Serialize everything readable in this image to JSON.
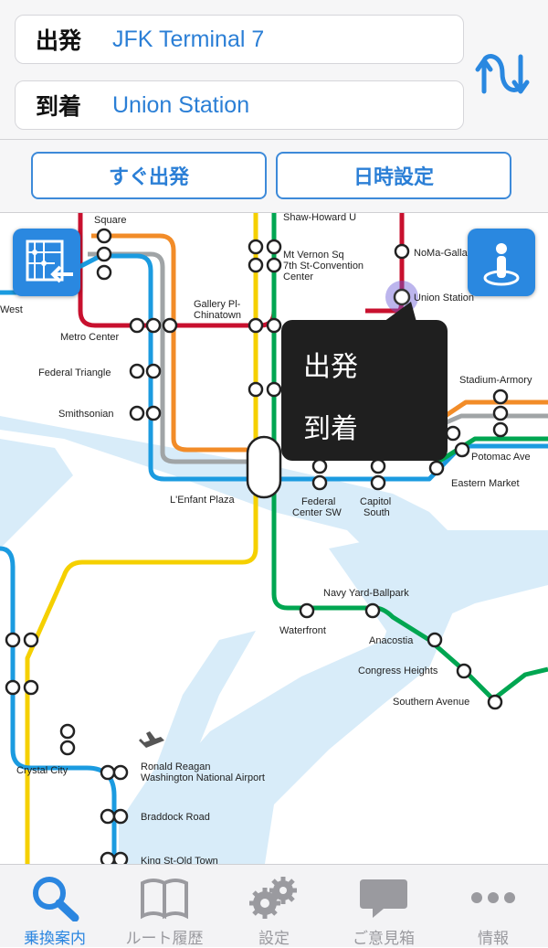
{
  "route": {
    "origin_label": "出発",
    "origin_value": "JFK Terminal 7",
    "destination_label": "到着",
    "destination_value": "Union Station"
  },
  "actions": {
    "depart_now": "すぐ出発",
    "set_datetime": "日時設定"
  },
  "popover": {
    "depart": "出発",
    "arrive": "到着"
  },
  "map": {
    "stations": {
      "square": "Square",
      "shaw": "Shaw-Howard U",
      "noma": "NoMa-Gallaudet",
      "union": "Union Station",
      "mtvernon1": "Mt Vernon Sq",
      "mtvernon2": "7th St-Convention",
      "mtvernon3": "Center",
      "gallery1": "Gallery Pl-",
      "gallery2": "Chinatown",
      "metro_center": "Metro Center",
      "federal_triangle": "Federal Triangle",
      "smithsonian": "Smithsonian",
      "lenfant": "L'Enfant Plaza",
      "federal_sw1": "Federal",
      "federal_sw2": "Center SW",
      "capitol_south1": "Capitol",
      "capitol_south2": "South",
      "stadium": "Stadium-Armory",
      "potomac": "Potomac Ave",
      "eastern": "Eastern Market",
      "navy_yard": "Navy Yard-Ballpark",
      "waterfront": "Waterfront",
      "anacostia": "Anacostia",
      "congress": "Congress Heights",
      "southern": "Southern Avenue",
      "crystal": "Crystal City",
      "reagan1": "Ronald Reagan",
      "reagan2": "Washington National Airport",
      "braddock": "Braddock Road",
      "kingst": "King St-Old Town",
      "west": "West"
    },
    "line_colors": {
      "red": "#c8102e",
      "orange": "#f28c28",
      "silver": "#a0a4a6",
      "blue": "#1b9be0",
      "yellow": "#f5d000",
      "green": "#00a651",
      "water": "#d8ecf9"
    }
  },
  "tabs": [
    {
      "label": "乗換案内",
      "icon": "search-icon",
      "active": true
    },
    {
      "label": "ルート履歴",
      "icon": "book-icon",
      "active": false
    },
    {
      "label": "設定",
      "icon": "gear-icon",
      "active": false
    },
    {
      "label": "ご意見箱",
      "icon": "speech-bubble-icon",
      "active": false
    },
    {
      "label": "情報",
      "icon": "more-dots-icon",
      "active": false
    }
  ]
}
